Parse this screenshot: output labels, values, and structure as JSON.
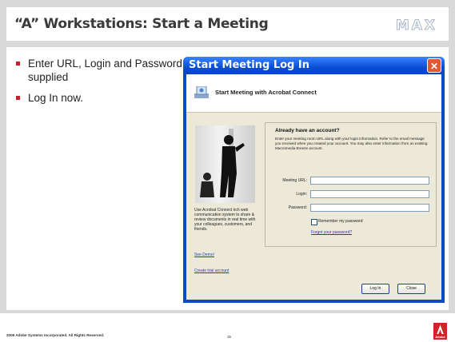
{
  "slide": {
    "title": "“A” Workstations: Start a Meeting",
    "brand_logo": "MAX",
    "bullets": [
      "Enter URL, Login and Password supplied",
      "Log In now."
    ],
    "footer": {
      "copyright": "2006 Adobe Systems Incorporated. All Rights Reserved.",
      "page_number": "35",
      "adobe_label": "Adobe"
    }
  },
  "dialog": {
    "title": "Start Meeting Log In",
    "header_text": "Start Meeting with Acrobat Connect",
    "promo_text": "Use Acrobat Connect rich web communication system to share & review documents in real time with your colleagues, customers, and friends.",
    "see_demo_link": "See Demo!",
    "create_trial_link": "Create trial account",
    "form": {
      "heading": "Already have an account?",
      "description": "Enter your meeting room URL along with your login information. Refer to the email message you received when you created your account. You may also enter information from an existing Macromedia Breeze account.",
      "meeting_url_label": "Meeting URL:",
      "login_label": "Login:",
      "password_label": "Password:",
      "meeting_url_value": "",
      "login_value": "",
      "password_value": "",
      "remember_label": "Remember my password",
      "forgot_link": "Forgot your password?"
    },
    "buttons": {
      "login": "Log In",
      "close": "Close"
    }
  },
  "colors": {
    "accent_red": "#c8202a",
    "dialog_blue": "#0a4ac4",
    "close_button": "#e35733"
  }
}
